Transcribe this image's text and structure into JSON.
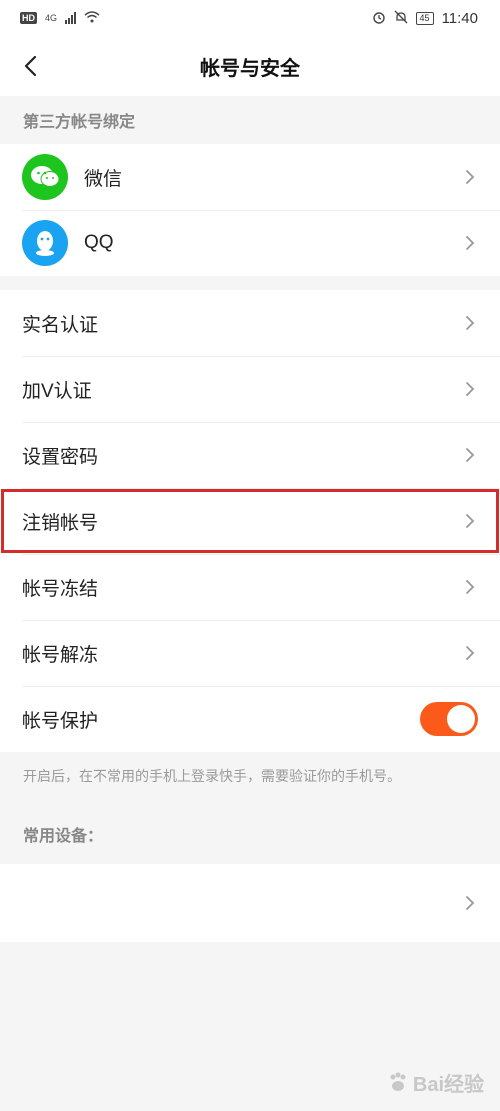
{
  "status_bar": {
    "left_badges": [
      "HD",
      "4G"
    ],
    "battery": "45",
    "time": "11:40"
  },
  "header": {
    "title": "帐号与安全"
  },
  "third_party": {
    "section_title": "第三方帐号绑定",
    "items": [
      {
        "label": "微信",
        "icon": "wechat-icon"
      },
      {
        "label": "QQ",
        "icon": "qq-icon"
      }
    ]
  },
  "settings": {
    "items": [
      {
        "label": "实名认证"
      },
      {
        "label": "加V认证"
      },
      {
        "label": "设置密码"
      },
      {
        "label": "注销帐号",
        "highlighted": true
      },
      {
        "label": "帐号冻结"
      },
      {
        "label": "帐号解冻"
      }
    ],
    "protection": {
      "label": "帐号保护",
      "enabled": true
    },
    "protection_note": "开启后，在不常用的手机上登录快手，需要验证你的手机号。"
  },
  "devices": {
    "section_title": "常用设备："
  },
  "watermark": "Bai经验",
  "colors": {
    "accent": "#fb5a1a",
    "wechat": "#1fc51f",
    "qq": "#1aa3f0",
    "highlight": "#d42b2b"
  }
}
